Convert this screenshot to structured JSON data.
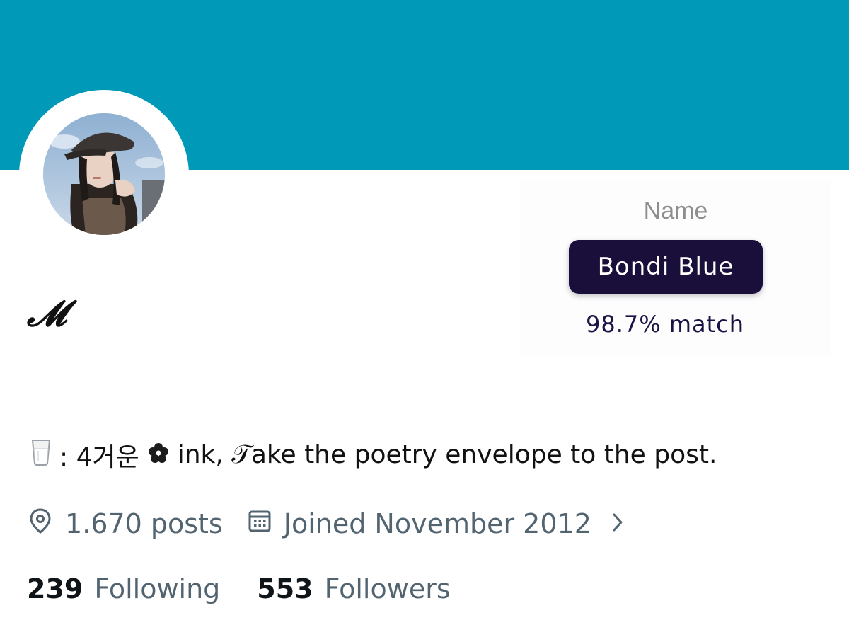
{
  "profile": {
    "display_name": "𝓜",
    "bio_prefix": ": 4거운",
    "bio_suffix": "ink, 𝒯ake the poetry envelope to the post.",
    "posts": "1.670 posts",
    "joined": "Joined November 2012",
    "following_count": "239",
    "following_label": "Following",
    "followers_count": "553",
    "followers_label": "Followers"
  },
  "color_card": {
    "label": "Name",
    "color_name": "Bondi Blue",
    "match": "98.7% match"
  },
  "icons": {
    "glass": "milk-glass-icon",
    "flower": "flower-icon",
    "location": "location-pin-icon",
    "calendar": "calendar-icon",
    "chevron": "chevron-right-icon"
  },
  "colors": {
    "banner": "#0099b8",
    "badge": "#1a0f3a",
    "secondary_text": "#536471"
  }
}
